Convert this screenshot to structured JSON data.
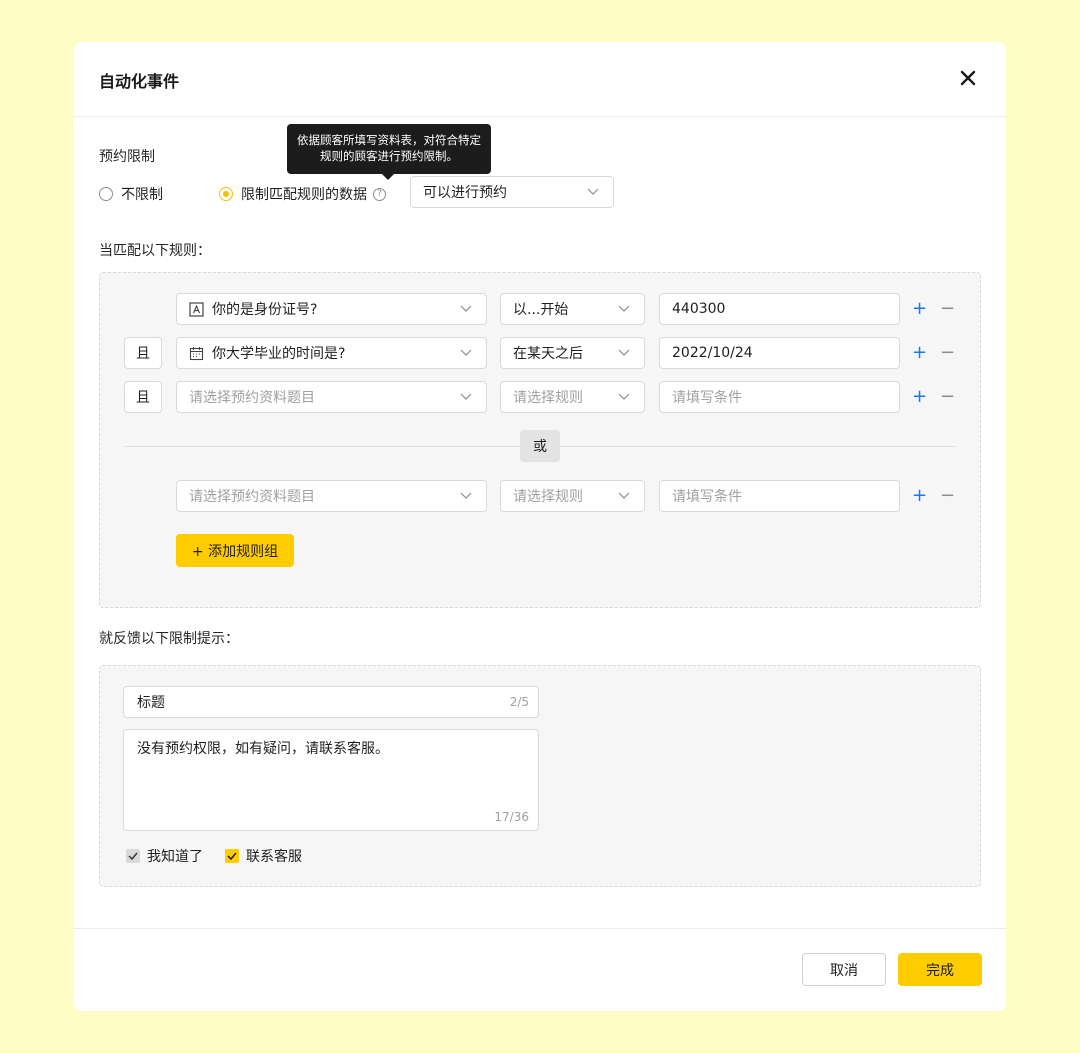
{
  "modal": {
    "title": "自动化事件",
    "close_icon": "close-icon"
  },
  "booking_limit": {
    "label": "预约限制",
    "option_unlimited": "不限制",
    "option_limit": "限制匹配规则的数据",
    "selected": "限制匹配规则的数据",
    "tooltip": "依据顾客所填写资料表，对符合特定规则的顾客进行预约限制。",
    "action_select": "可以进行预约"
  },
  "rules": {
    "label": "当匹配以下规则：",
    "and_label": "且",
    "or_label": "或",
    "rows": [
      {
        "question": "你的是身份证号?",
        "question_icon": "text-field-icon",
        "rule": "以...开始",
        "condition": "440300"
      },
      {
        "question": "你大学毕业的时间是?",
        "question_icon": "calendar-icon",
        "rule": "在某天之后",
        "condition": "2022/10/24"
      },
      {
        "question_placeholder": "请选择预约资料题目",
        "rule_placeholder": "请选择规则",
        "condition_placeholder": "请填写条件"
      }
    ],
    "group2_row": {
      "question_placeholder": "请选择预约资料题目",
      "rule_placeholder": "请选择规则",
      "condition_placeholder": "请填写条件"
    },
    "add_group": "+ 添加规则组",
    "plus": "+",
    "minus": "−"
  },
  "feedback": {
    "label": "就反馈以下限制提示：",
    "title_value": "标题",
    "title_count": "2/5",
    "message": "没有预约权限，如有疑问，请联系客服。",
    "message_count": "17/36",
    "check_known": "我知道了",
    "check_known_checked": true,
    "check_contact": "联系客服",
    "check_contact_checked": true
  },
  "footer": {
    "cancel": "取消",
    "done": "完成"
  },
  "colors": {
    "accent": "#ffcc00",
    "page_bg": "#fffdc6",
    "link_blue": "#1677ff"
  }
}
